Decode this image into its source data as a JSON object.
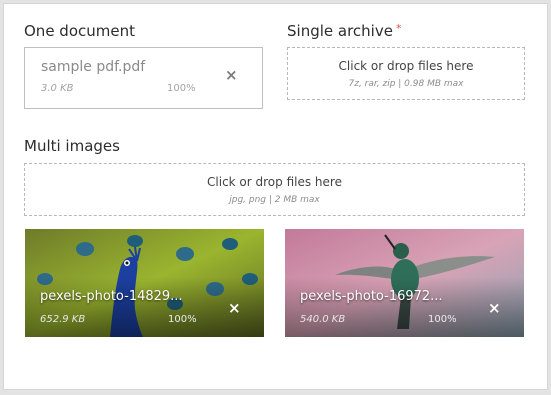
{
  "one_document": {
    "label": "One document",
    "file": {
      "name": "sample pdf.pdf",
      "size": "3.0 KB",
      "progress": "100%",
      "remove_icon": "×"
    }
  },
  "single_archive": {
    "label": "Single archive",
    "required_mark": "*",
    "dropzone": {
      "text": "Click or drop files here",
      "hint": "7z, rar, zip  |  0.98 MB max"
    }
  },
  "multi_images": {
    "label": "Multi images",
    "dropzone": {
      "text": "Click or drop files here",
      "hint": "jpg, png  |  2 MB max"
    },
    "files": [
      {
        "name": "pexels-photo-14829...",
        "size": "652.9 KB",
        "progress": "100%",
        "remove_icon": "×"
      },
      {
        "name": "pexels-photo-16972...",
        "size": "540.0 KB",
        "progress": "100%",
        "remove_icon": "×"
      }
    ]
  },
  "colors": {
    "required": "#e0533a",
    "border": "#bfbfbf",
    "dropzone_border": "#b9b9b9"
  }
}
